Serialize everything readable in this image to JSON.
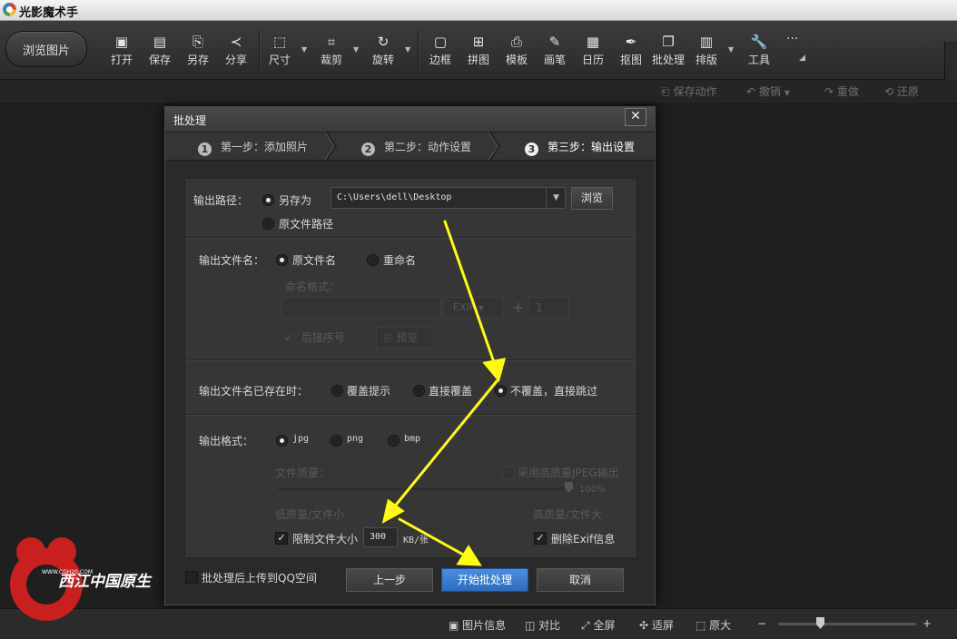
{
  "app": {
    "title": "光影魔术手"
  },
  "toolbar": {
    "browse": "浏览图片",
    "tools": [
      {
        "label": "打开",
        "icon": "image-open-icon"
      },
      {
        "label": "保存",
        "icon": "save-icon"
      },
      {
        "label": "另存",
        "icon": "save-as-icon"
      },
      {
        "label": "分享",
        "icon": "share-icon"
      },
      {
        "label": "尺寸",
        "icon": "resize-icon"
      },
      {
        "label": "裁剪",
        "icon": "crop-icon"
      },
      {
        "label": "旋转",
        "icon": "rotate-icon"
      },
      {
        "label": "边框",
        "icon": "frame-icon"
      },
      {
        "label": "拼图",
        "icon": "collage-icon"
      },
      {
        "label": "模板",
        "icon": "template-icon"
      },
      {
        "label": "画笔",
        "icon": "brush-icon"
      },
      {
        "label": "日历",
        "icon": "calendar-icon"
      },
      {
        "label": "抠图",
        "icon": "cutout-icon"
      },
      {
        "label": "批处理",
        "icon": "batch-icon"
      },
      {
        "label": "排版",
        "icon": "layout-icon"
      },
      {
        "label": "工具",
        "icon": "wrench-icon"
      }
    ],
    "more": "···"
  },
  "actionbar": {
    "save_action": "保存动作",
    "undo": "撤销",
    "redo": "重做",
    "restore": "还原"
  },
  "dialog": {
    "title": "批处理",
    "close": "✕",
    "steps": [
      {
        "num": "1",
        "label": "第一步：添加照片"
      },
      {
        "num": "2",
        "label": "第二步：动作设置"
      },
      {
        "num": "3",
        "label": "第三步：输出设置"
      }
    ],
    "output_path": {
      "label": "输出路径：",
      "save_as": "另存为",
      "path_value": "C:\\Users\\dell\\Desktop",
      "browse": "浏览",
      "original": "原文件路径"
    },
    "filename": {
      "label": "输出文件名：",
      "original": "原文件名",
      "rename": "重命名",
      "format_label": "命名格式：",
      "exif": "EXIF",
      "plus": "+",
      "seq": "1",
      "append_seq": "后接序号",
      "preview": "预览"
    },
    "exists": {
      "label": "输出文件名已存在时：",
      "opt1": "覆盖提示",
      "opt2": "直接覆盖",
      "opt3": "不覆盖，直接跳过"
    },
    "format": {
      "label": "输出格式：",
      "jpg": "jpg",
      "png": "png",
      "bmp": "bmp",
      "quality_label": "文件质量：",
      "hq_jpeg": "采用高质量JPEG输出",
      "quality_pct": "100%",
      "low": "低质量/文件小",
      "high": "高质量/文件大",
      "limit_size": "限制文件大小",
      "size_value": "300",
      "size_unit": "KB/张",
      "remove_exif": "删除Exif信息"
    },
    "upload_qzone": "批处理后上传到QQ空间",
    "prev": "上一步",
    "start": "开始批处理",
    "cancel": "取消"
  },
  "statusbar": {
    "info": "图片信息",
    "compare": "对比",
    "fullscreen": "全屏",
    "fit": "适屏",
    "original": "原大",
    "minus": "−",
    "plus": "+"
  },
  "watermark": {
    "site": "WWW.CGH20.COM",
    "text": "西江中国原生"
  },
  "colors": {
    "accent": "#3a7bd5",
    "arrow": "#ffff00",
    "bg": "#202020"
  }
}
